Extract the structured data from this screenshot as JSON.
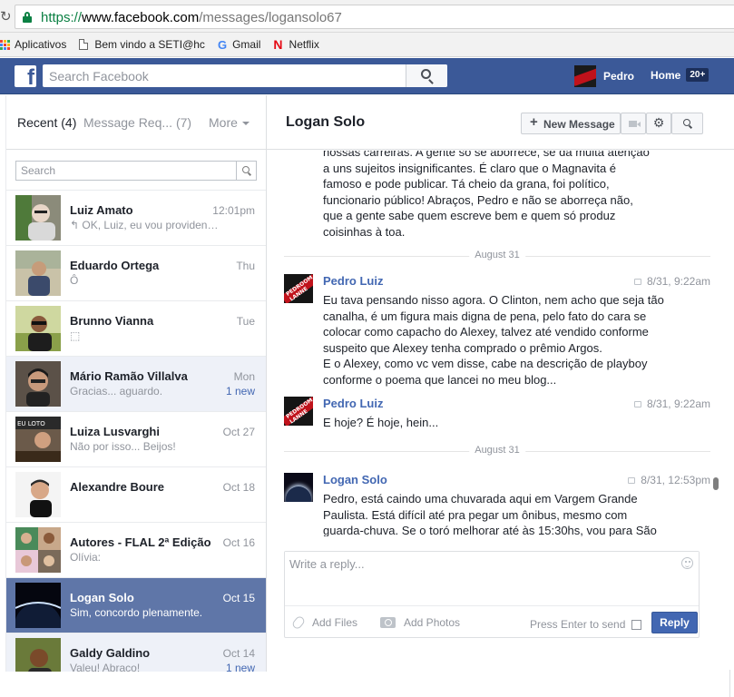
{
  "browser": {
    "url_scheme": "https://",
    "url_host": "www.facebook.com",
    "url_path": "/messages/logansolo67",
    "bookmarks": [
      {
        "label": "Aplicativos",
        "icon": "apps-grid-icon"
      },
      {
        "label": "Bem vindo a SETI@hc",
        "icon": "document-icon"
      },
      {
        "label": "Gmail",
        "icon": "google-g-icon",
        "glyph": "G"
      },
      {
        "label": "Netflix",
        "icon": "netflix-n-icon",
        "glyph": "N"
      }
    ]
  },
  "topbar": {
    "logo_glyph": "f",
    "search_placeholder": "Search Facebook",
    "profile_name": "Pedro",
    "home_label": "Home",
    "home_badge": "20+",
    "colors": {
      "bar": "#3b5998",
      "accent": "#4267b2"
    }
  },
  "left": {
    "tab_recent": "Recent",
    "tab_recent_count": "(4)",
    "tab_requests": "Message Req...",
    "tab_requests_count": "(7)",
    "tab_more": "More",
    "search_placeholder": "Search",
    "threads": [
      {
        "name": "Luiz Amato",
        "time": "12:01pm",
        "snippet": "↰ OK, Luiz, eu vou providen…",
        "badge": "",
        "state": "normal"
      },
      {
        "name": "Eduardo Ortega",
        "time": "Thu",
        "snippet": "Ô",
        "badge": "",
        "state": "normal"
      },
      {
        "name": "Brunno Vianna",
        "time": "Tue",
        "snippet": "⬚",
        "badge": "",
        "state": "normal"
      },
      {
        "name": "Mário Ramão Villalva",
        "time": "Mon",
        "snippet": "Gracias... aguardo.",
        "badge": "1 new",
        "state": "unread"
      },
      {
        "name": "Luiza Lusvarghi",
        "time": "Oct 27",
        "snippet": "Não por isso... Beijos!",
        "badge": "",
        "state": "normal"
      },
      {
        "name": "Alexandre Boure",
        "time": "Oct 18",
        "snippet": "",
        "badge": "",
        "state": "normal"
      },
      {
        "name": "Autores - FLAL 2ª Edição",
        "time": "Oct 16",
        "snippet": "Olívia:",
        "badge": "",
        "state": "normal"
      },
      {
        "name": "Logan Solo",
        "time": "Oct 15",
        "snippet": "Sim, concordo plenamente.",
        "badge": "",
        "state": "active"
      },
      {
        "name": "Galdy Galdino",
        "time": "Oct 14",
        "snippet": "Valeu! Abraço!",
        "badge": "1 new",
        "state": "unread"
      }
    ]
  },
  "conversation": {
    "title": "Logan Solo",
    "new_message_label": "New Message",
    "gear_glyph": "⚙",
    "previous_text": "nossas carreiras. A gente só se aborrece, se dá muita atenção a uns sujeitos insignificantes. É claro que o Magnavita é famoso e pode publicar. Tá cheio da grana, foi político, funcionario público! Abraços, Pedro e não se aborreça não, que a gente sabe quem escreve bem e quem só produz coisinhas  à toa.",
    "date_dividers": [
      "August 31",
      "August 31"
    ],
    "messages": [
      {
        "sender": "Pedro Luiz",
        "time": "8/31, 9:22am",
        "text": "Eu tava pensando nisso agora. O Clinton, nem acho que seja tão canalha, é um figura mais digna de pena, pelo fato do cara se colocar como capacho do Alexey, talvez até vendido conforme suspeito que Alexey tenha comprado o prêmio Argos.\nE o Alexey, como vc vem disse, cabe na descrição de playboy conforme o poema que lancei no meu blog..."
      },
      {
        "sender": "Pedro Luiz",
        "time": "8/31, 9:22am",
        "text": "E hoje? É hoje, hein..."
      },
      {
        "sender": "Logan Solo",
        "time": "8/31, 12:53pm",
        "text": "Pedro, está caindo uma chuvarada aqui em Vargem Grande Paulista. Está difícil até pra pegar um ônibus, mesmo com guarda-chuva. Se o toró melhorar até às 15:30hs, vou para São"
      }
    ],
    "avatar_text": "PEDROOM LANNE"
  },
  "composer": {
    "placeholder": "Write a reply...",
    "add_files": "Add Files",
    "add_photos": "Add Photos",
    "press_enter": "Press Enter to send",
    "reply_label": "Reply"
  }
}
